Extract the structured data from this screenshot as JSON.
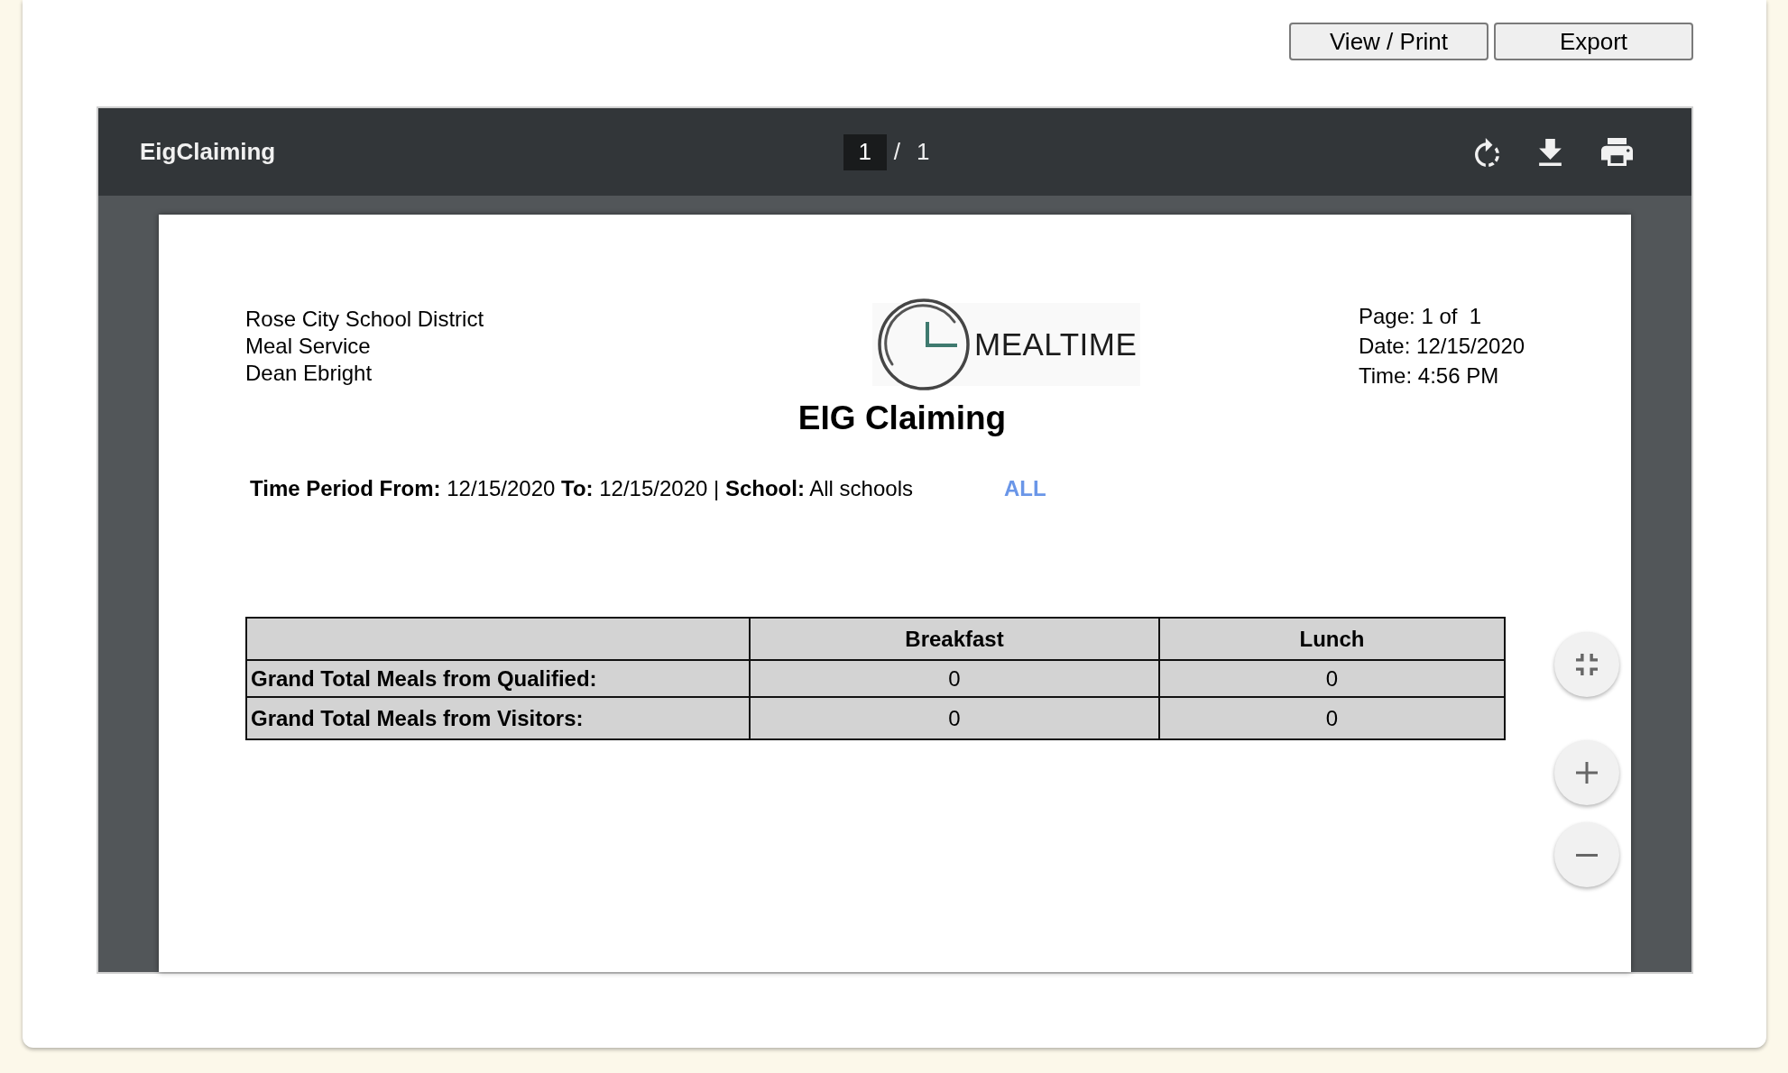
{
  "action_buttons": [
    {
      "label": "View / Print"
    },
    {
      "label": "Export"
    }
  ],
  "viewer": {
    "title": "EigClaiming",
    "page_field": {
      "value": "1"
    },
    "separator": "/",
    "page_total": "1"
  },
  "report": {
    "org_lines": [
      "Rose City School District",
      "Meal Service",
      "Dean Ebright"
    ],
    "logo": {
      "text": "MEALTIME"
    },
    "meta_lines": [
      "Page: 1 of  1",
      "Date: 12/15/2020",
      "Time: 4:56 PM"
    ],
    "title": "EIG Claiming",
    "period": "**Time Period From:** 12/15/2020 **To:** 12/15/2020 | **School:** All schools",
    "filter_label": "ALL",
    "table": {
      "columns": [
        "Breakfast",
        "Lunch"
      ],
      "rows": [
        {
          "label": "Grand Total Meals from Qualified:",
          "cells": [
            "0",
            "0"
          ]
        },
        {
          "label": "Grand Total Meals from Visitors:",
          "cells": [
            "0",
            "0"
          ]
        }
      ]
    }
  }
}
